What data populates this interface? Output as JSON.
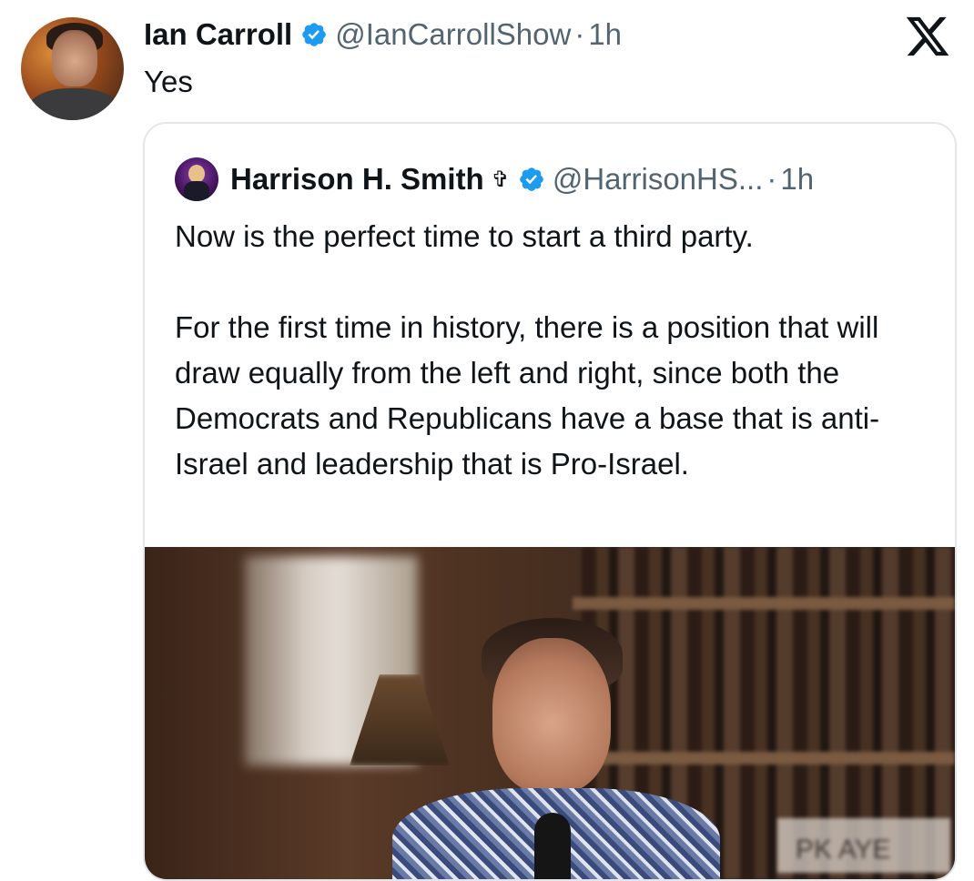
{
  "tweet": {
    "author_name": "Ian Carroll",
    "handle": "@IanCarrollShow",
    "separator": "·",
    "time": "1h",
    "text": "Yes"
  },
  "quoted_tweet": {
    "author_name": "Harrison H. Smith",
    "author_emoji": "✞",
    "handle": "@HarrisonHS...",
    "separator": "·",
    "time": "1h",
    "paragraphs": [
      "Now is the perfect time to start a third party.",
      "For the first time in history, there is a position that will draw equally from the left and right, since both the Democrats and Republicans have a base that is anti-Israel and leadership that is Pro-Israel."
    ],
    "media": {
      "type": "video-thumbnail",
      "visible_sign_text": "PK AYE"
    }
  },
  "icons": {
    "verified": "verified-badge-icon",
    "platform": "x-logo-icon"
  },
  "colors": {
    "text": "#0f1419",
    "muted": "#536471",
    "verified_blue": "#1d9bf0",
    "border": "#e3e7ea"
  }
}
